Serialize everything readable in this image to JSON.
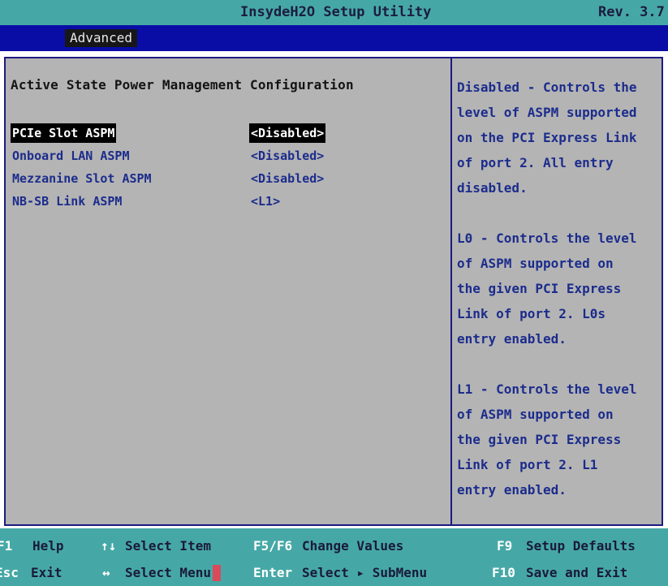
{
  "header": {
    "app_title": "InsydeH2O Setup Utility",
    "revision": "Rev. 3.7"
  },
  "menu": {
    "active_tab": "Advanced"
  },
  "page": {
    "section_title": "Active State Power Management Configuration",
    "settings": [
      {
        "label": "PCIe Slot ASPM",
        "value": "<Disabled>",
        "selected": true
      },
      {
        "label": "Onboard LAN ASPM",
        "value": "<Disabled>",
        "selected": false
      },
      {
        "label": "Mezzanine Slot ASPM",
        "value": "<Disabled>",
        "selected": false
      },
      {
        "label": "NB-SB Link ASPM",
        "value": "<L1>",
        "selected": false
      }
    ]
  },
  "help": {
    "paragraphs": [
      [
        "Disabled - Controls the",
        "level of ASPM supported",
        "on the PCI Express Link",
        "of port 2. All entry",
        "disabled."
      ],
      [
        "L0 - Controls the level",
        "of ASPM supported on",
        "the given PCI Express",
        "Link of port 2. L0s",
        "entry enabled."
      ],
      [
        "L1 - Controls the level",
        "of ASPM supported on",
        "the given PCI Express",
        "Link of port 2. L1",
        "entry enabled."
      ]
    ]
  },
  "footer": {
    "f1_key": "F1",
    "f1_desc": "Help",
    "updown_key": "↑↓",
    "updown_desc": "Select Item",
    "f5f6_key": "F5/F6",
    "f5f6_desc": "Change Values",
    "f9_key": "F9",
    "f9_desc": "Setup Defaults",
    "esc_key": "Esc",
    "esc_desc": "Exit",
    "leftright_key": "↔",
    "leftright_desc": "Select Menu",
    "enter_key": "Enter",
    "enter_desc": "Select ▸ SubMenu",
    "f10_key": "F10",
    "f10_desc": "Save and Exit"
  },
  "colors": {
    "title_bar": "#46a8a6",
    "menu_bar": "#0a0ca6",
    "panel_bg": "#b4b4b4",
    "text_blue": "#1c2c8c",
    "selection_bg": "#000000"
  }
}
